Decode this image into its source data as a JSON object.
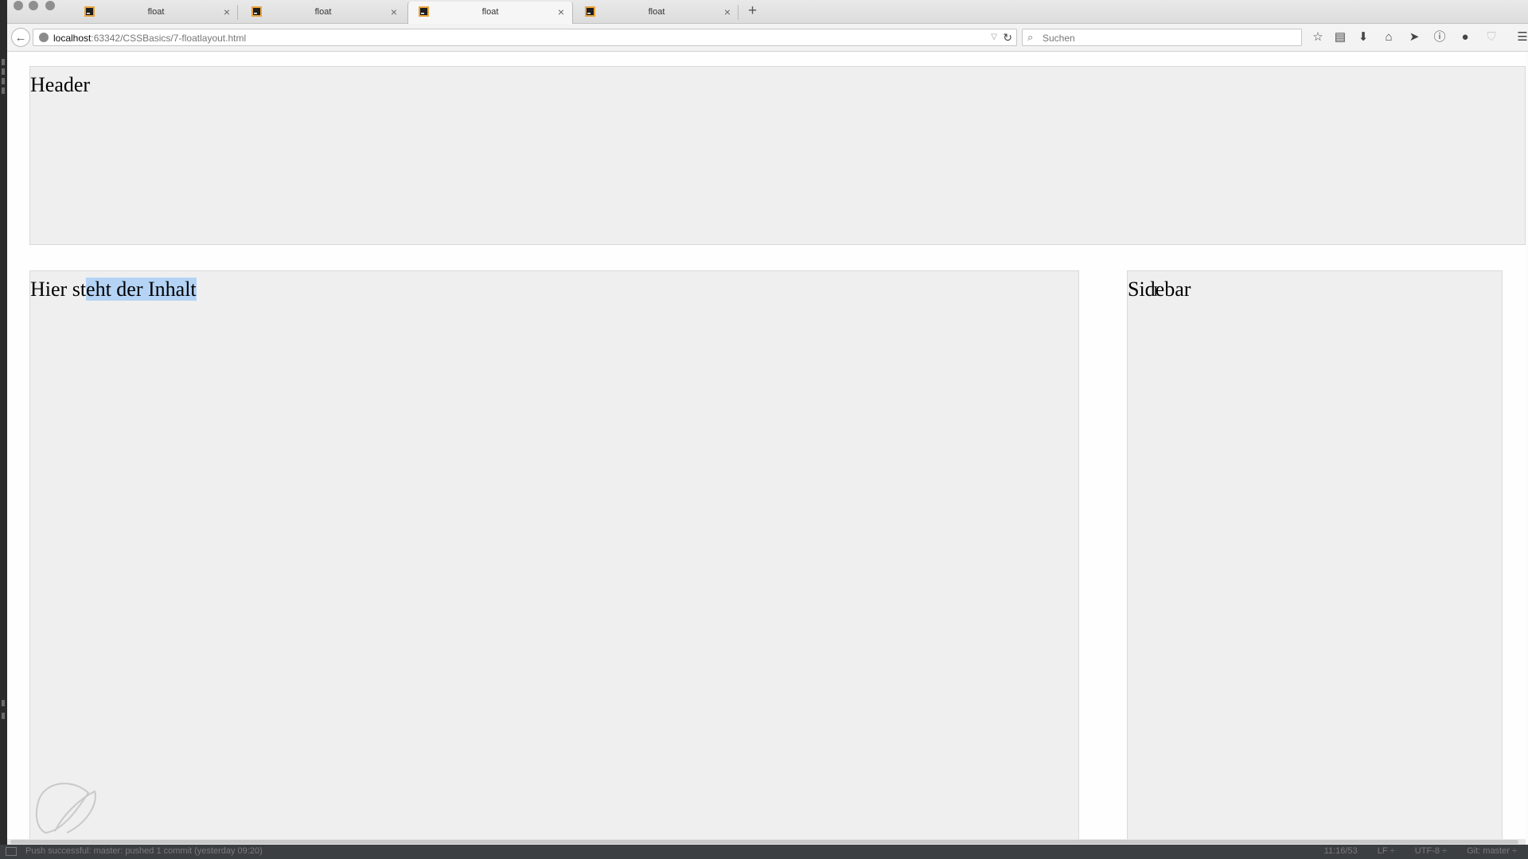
{
  "browser": {
    "tabs": [
      {
        "title": "float",
        "close": "×",
        "active": false
      },
      {
        "title": "float",
        "close": "×",
        "active": false
      },
      {
        "title": "float",
        "close": "×",
        "active": true
      },
      {
        "title": "float",
        "close": "×",
        "active": false
      }
    ],
    "new_tab": "+",
    "back": "←",
    "url_host": "localhost",
    "url_rest": ":63342/CSSBasics/7-floatlayout.html",
    "reload": "↻",
    "dropdown": "▽",
    "search_placeholder": "Suchen",
    "toolbar_icons": [
      "bookmark-star-icon",
      "reading-list-icon",
      "download-icon",
      "home-icon",
      "send-icon",
      "info-icon",
      "chat-icon",
      "shield-icon",
      "menu-icon"
    ]
  },
  "page": {
    "header_text": "Header",
    "content_text_before": "Hier st",
    "content_text_selected": "eht der Inhalt",
    "sidebar_text": "Sidebar"
  },
  "statusbar": {
    "left": "Push successful: master: pushed 1 commit (yesterday 09:20)",
    "right": [
      "11:16/53",
      "LF ÷",
      "UTF-8 ÷",
      "Git: master ÷"
    ]
  },
  "colors": {
    "box_bg": "#efefef",
    "selection": "#b4d3f5"
  }
}
